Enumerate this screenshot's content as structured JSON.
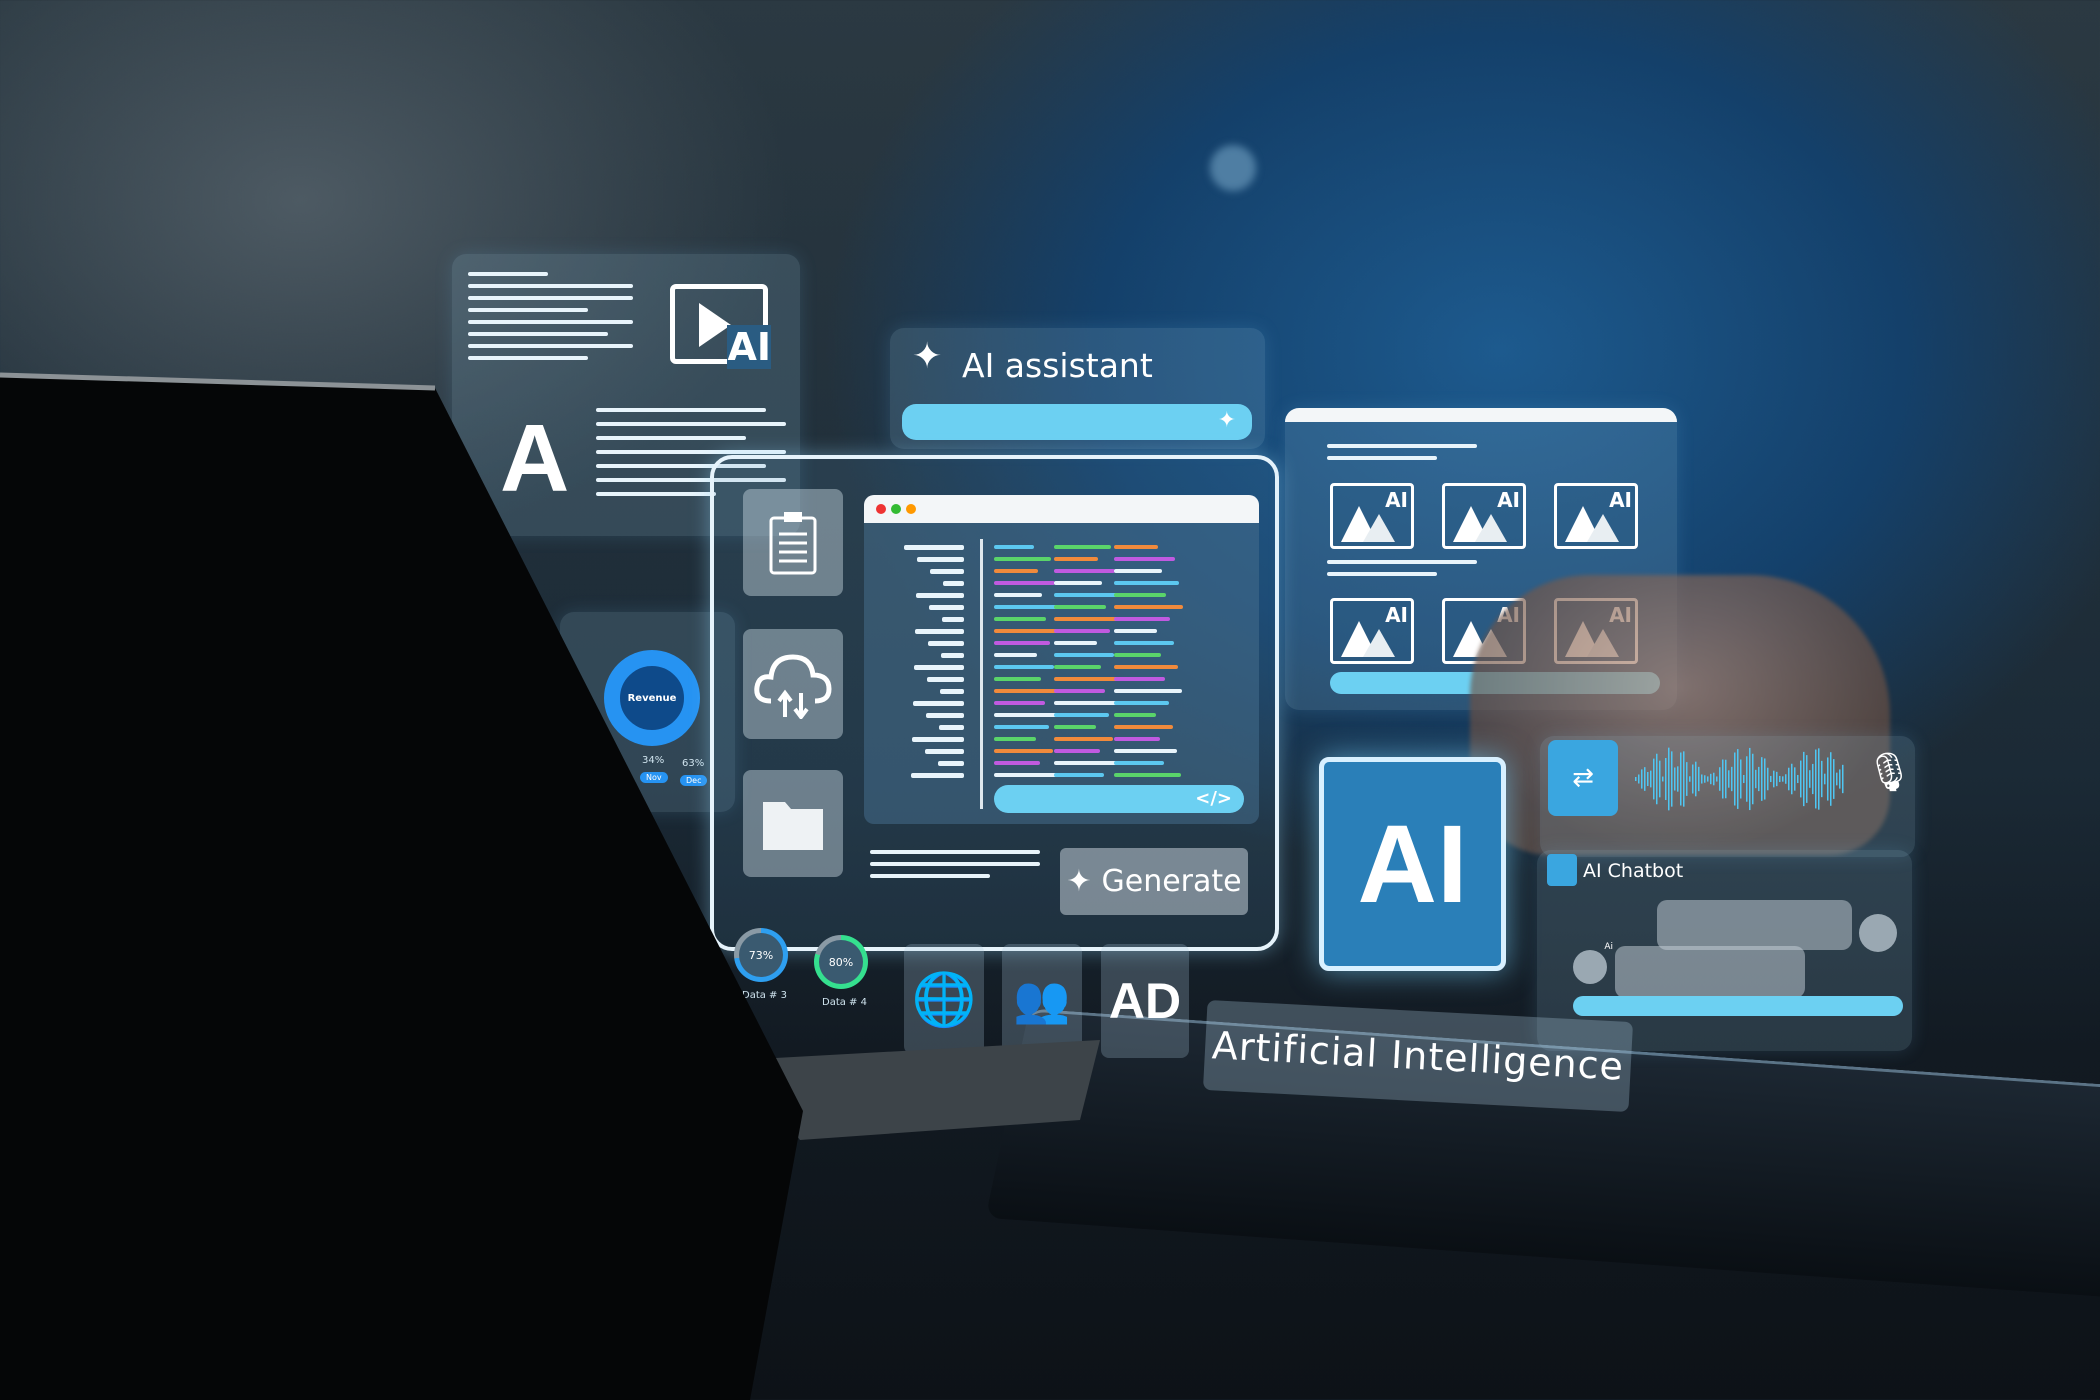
{
  "doc_panel": {
    "letter": "A",
    "video_ai_label": "AI"
  },
  "ai_assistant": {
    "title": "AI assistant",
    "icon": "sparkle-icon"
  },
  "code_window": {
    "code_tag": "</>",
    "generate_label": "Generate"
  },
  "sidebar_icons": [
    "clipboard-icon",
    "cloud-sync-icon",
    "folder-icon"
  ],
  "gallery": {
    "tile_label": "AI",
    "count": 6
  },
  "ai_tile": {
    "label": "AI"
  },
  "revenue": {
    "label": "Revenue",
    "stats": [
      {
        "value": "34%",
        "month": "Nov"
      },
      {
        "value": "63%",
        "month": "Dec"
      }
    ]
  },
  "gauges": [
    {
      "value": "73%",
      "label": "Data # 3",
      "percent": 73,
      "color": "#2e9ff0"
    },
    {
      "value": "80%",
      "label": "Data # 4",
      "percent": 80,
      "color": "#35e08f"
    }
  ],
  "bottom_icons": {
    "ad_label": "AD"
  },
  "banner": {
    "text": "Artificial Intelligence"
  },
  "chatbot": {
    "title": "AI Chatbot",
    "bot_badge": "Ai"
  },
  "colors": {
    "accent": "#6cd0f2",
    "panel": "#8fc8e6",
    "gauge_blue": "#2e9ff0",
    "gauge_green": "#35e08f"
  }
}
